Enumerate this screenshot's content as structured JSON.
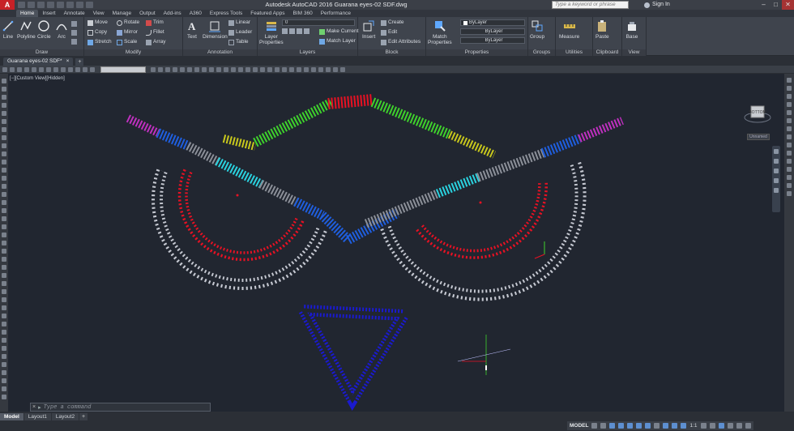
{
  "app": {
    "window_title": "Autodesk AutoCAD 2016    Guarana eyes-02 SDF.dwg",
    "search_placeholder": "Type a keyword or phrase",
    "sign_in": "Sign In",
    "logo": "A"
  },
  "ribbon_tabs": [
    "Home",
    "Insert",
    "Annotate",
    "View",
    "Manage",
    "Output",
    "Add-ins",
    "A360",
    "Express Tools",
    "Featured Apps",
    "BIM 360",
    "Performance"
  ],
  "panels": {
    "draw": {
      "title": "Draw",
      "line": "Line",
      "polyline": "Polyline",
      "circle": "Circle",
      "arc": "Arc"
    },
    "modify": {
      "title": "Modify",
      "move": "Move",
      "rotate": "Rotate",
      "trim": "Trim",
      "copy": "Copy",
      "mirror": "Mirror",
      "fillet": "Fillet",
      "stretch": "Stretch",
      "scale": "Scale",
      "array": "Array"
    },
    "annotation": {
      "title": "Annotation",
      "text": "Text",
      "dimension": "Dimension",
      "linear": "Linear",
      "leader": "Leader",
      "table": "Table"
    },
    "layers": {
      "title": "Layers",
      "layer_properties": "Layer\nProperties",
      "layer_value": "0",
      "make_current": "Make Current",
      "match_layer": "Match Layer"
    },
    "block": {
      "title": "Block",
      "insert": "Insert",
      "create": "Create",
      "edit": "Edit",
      "edit_attributes": "Edit Attributes"
    },
    "properties": {
      "title": "Properties",
      "match_properties": "Match\nProperties",
      "color": "ByLayer",
      "linetype": "ByLayer",
      "lineweight": "ByLayer"
    },
    "groups": {
      "title": "Groups",
      "group": "Group"
    },
    "utilities": {
      "title": "Utilities",
      "measure": "Measure"
    },
    "clipboard": {
      "title": "Clipboard",
      "paste": "Paste"
    },
    "view": {
      "title": "View",
      "base": "Base"
    }
  },
  "document": {
    "tab": "Guarana eyes-02 SDF*",
    "view_label": "[−][Custom View][Hidden]",
    "viewcube_face": "BOTTOM",
    "named_view": "Unnamed"
  },
  "command": {
    "placeholder": "Type a command",
    "close": "×"
  },
  "layout_tabs": [
    "Model",
    "Layout1",
    "Layout2"
  ],
  "status": {
    "space": "MODEL",
    "scale": "1:1"
  },
  "colors": {
    "background": "#212630",
    "truss_white": "#d8dce4",
    "truss_red": "#e81123",
    "truss_blue": "#1f5fe0",
    "truss_green": "#3fd22c",
    "truss_yellow": "#c8c81c",
    "truss_cyan": "#2ad3e0",
    "truss_magenta": "#c030c0",
    "truss_gray": "#8c9099",
    "triangle_blue": "#1a1ad0"
  }
}
